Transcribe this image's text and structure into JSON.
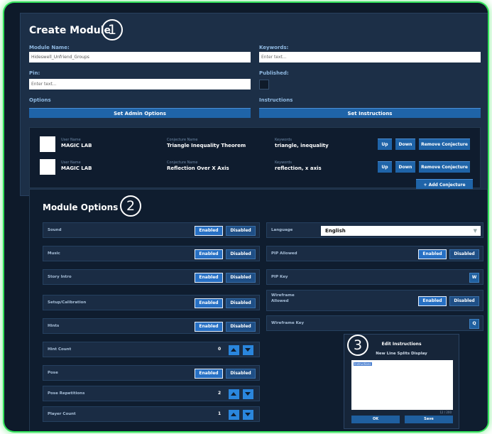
{
  "create_module": {
    "title": "Create Module",
    "badge": "1",
    "module_name": {
      "label": "Module Name:",
      "value": "Hideswell_Unfriend_Groups"
    },
    "keywords": {
      "label": "Keywords:",
      "placeholder": "Enter text..."
    },
    "pin": {
      "label": "Pin:",
      "placeholder": "Enter text..."
    },
    "published": {
      "label": "Published:",
      "checked": false
    },
    "options_label": "Options",
    "instructions_label": "Instructions",
    "set_admin_options": "Set Admin Options",
    "set_instructions": "Set Instructions",
    "conjectures": [
      {
        "user_caption": "User Name",
        "user": "MAGIC LAB",
        "name_caption": "Conjecture Name",
        "name": "Triangle Inequality Theorem",
        "kw_caption": "Keywords",
        "keywords": "triangle, inequality"
      },
      {
        "user_caption": "User Name",
        "user": "MAGIC LAB",
        "name_caption": "Conjecture Name",
        "name": "Reflection Over X Axis",
        "kw_caption": "Keywords",
        "keywords": "reflection, x axis"
      }
    ],
    "row_buttons": {
      "up": "Up",
      "down": "Down",
      "remove": "Remove Conjecture"
    },
    "add_conjecture": "+ Add Conjecture"
  },
  "module_options": {
    "title": "Module Options",
    "badge": "2",
    "toggle_labels": {
      "enabled": "Enabled",
      "disabled": "Disabled"
    },
    "left": [
      {
        "label": "Sound",
        "kind": "toggle",
        "state": "enabled"
      },
      {
        "label": "Music",
        "kind": "toggle",
        "state": "enabled"
      },
      {
        "label": "Story Intro",
        "kind": "toggle",
        "state": "enabled"
      },
      {
        "label": "Setup/Calibration",
        "kind": "toggle",
        "state": "enabled"
      },
      {
        "label": "Hints",
        "kind": "toggle",
        "state": "enabled"
      },
      {
        "label": "Hint Count",
        "kind": "stepper",
        "value": "0"
      },
      {
        "label": "Pose",
        "kind": "toggle",
        "state": "enabled"
      },
      {
        "label": "Pose Repetitions",
        "kind": "stepper",
        "value": "2"
      },
      {
        "label": "Player Count",
        "kind": "stepper",
        "value": "1"
      }
    ],
    "right": {
      "language": {
        "label": "Language",
        "value": "English"
      },
      "pip_allowed": {
        "label": "PIP Allowed",
        "state": "enabled"
      },
      "pip_key": {
        "label": "PIP Key",
        "value": "W"
      },
      "wireframe_allowed": {
        "label_line1": "Wireframe",
        "label_line2": "Allowed",
        "state": "enabled"
      },
      "wireframe_key": {
        "label": "Wireframe Key",
        "value": "Q"
      }
    }
  },
  "instructions_popup": {
    "badge": "3",
    "title": "Edit Instructions",
    "subtitle": "New Line Splits Display",
    "selected_text": "Instructions",
    "char_count": "12 / 200",
    "ok": "OK",
    "save": "Save"
  },
  "colors": {
    "glow": "#33e05a",
    "background": "#0e1a2a",
    "panel": "#1c2f47",
    "button": "#1f64a8",
    "arrow": "#2a86dd"
  }
}
